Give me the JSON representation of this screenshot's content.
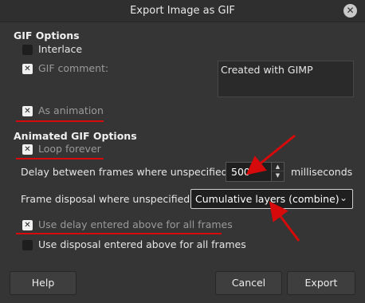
{
  "window": {
    "title": "Export Image as GIF",
    "close_glyph": "✕"
  },
  "gif_options": {
    "heading": "GIF Options",
    "interlace": {
      "label": "Interlace",
      "checked": false
    },
    "gif_comment": {
      "label": "GIF comment:",
      "checked": true,
      "value": "Created with GIMP"
    },
    "as_animation": {
      "label": "As animation",
      "checked": true
    }
  },
  "animated_options": {
    "heading": "Animated GIF Options",
    "loop_forever": {
      "label": "Loop forever",
      "checked": true
    },
    "delay": {
      "label": "Delay between frames where unspecified:",
      "value": "500",
      "unit": "milliseconds"
    },
    "disposal": {
      "label": "Frame disposal where unspecified:",
      "selected": "Cumulative layers (combine)"
    },
    "use_delay": {
      "label": "Use delay entered above for all frames",
      "checked": true
    },
    "use_disposal": {
      "label": "Use disposal entered above for all frames",
      "checked": false
    }
  },
  "buttons": {
    "help": "Help",
    "cancel": "Cancel",
    "export": "Export"
  },
  "icons": {
    "check": "✕",
    "spin_up": "▲",
    "spin_down": "▼",
    "dropdown": "⌄"
  },
  "colors": {
    "annotation": "#d60a0a",
    "background": "#353535"
  }
}
